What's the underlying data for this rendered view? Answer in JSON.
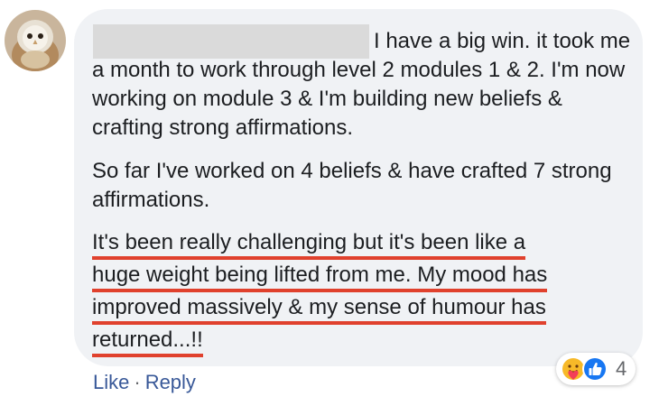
{
  "comment": {
    "author_redacted": true,
    "paragraphs": [
      "I have a big win. it took me a month to work through level 2 modules 1 & 2. I'm now working on module 3 & I'm building new beliefs & crafting strong affirmations.",
      "So far I've worked on 4 beliefs & have crafted 7 strong affirmations."
    ],
    "highlighted_lines": [
      "It's been really challenging but it's been like a",
      "huge weight being lifted from me. My mood has",
      "improved massively & my sense of humour has",
      "returned...!!"
    ],
    "highlight_color": "#e0412d",
    "bubble_color": "#f0f2f5"
  },
  "reactions": {
    "icons": [
      "care-icon",
      "like-icon"
    ],
    "count": "4"
  },
  "actions": {
    "like_label": "Like",
    "separator": "·",
    "reply_label": "Reply"
  },
  "colors": {
    "link": "#385898",
    "text": "#1c1e21",
    "like_blue": "#1877f2"
  }
}
